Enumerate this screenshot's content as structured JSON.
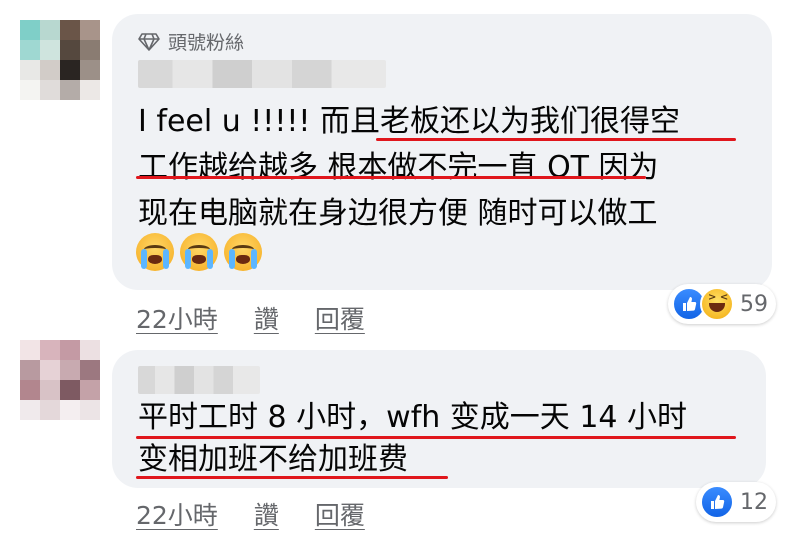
{
  "comment1": {
    "badge_label": "頭號粉絲",
    "lines": [
      "I feel u !!!!! 而且老板还以为我们很得空",
      "工作越给越多 根本做不完一直 OT 因为",
      "现在电脑就在身边很方便 随时可以做工"
    ],
    "emojis": [
      "crying-face",
      "crying-face",
      "crying-face"
    ],
    "time": "22小時",
    "like_label": "讚",
    "reply_label": "回覆",
    "reaction_count": "59",
    "reaction_icons": [
      "like-icon",
      "haha-icon"
    ]
  },
  "comment2": {
    "lines": [
      "平时工时 8 小时，wfh 变成一天 14 小时",
      "变相加班不给加班费"
    ],
    "time": "22小時",
    "like_label": "讚",
    "reply_label": "回覆",
    "reaction_count": "12",
    "reaction_icons": [
      "like-icon"
    ]
  },
  "colors": {
    "bubble": "#f0f2f5",
    "underline": "#e0161c",
    "meta_text": "#65676b",
    "like_blue": "#1877f2"
  }
}
